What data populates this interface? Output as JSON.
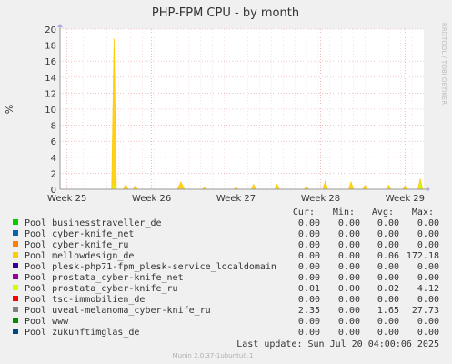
{
  "chart_data": {
    "type": "area",
    "title": "PHP-FPM CPU - by month",
    "ylabel": "%",
    "xlabel": "",
    "ylim": [
      0,
      20
    ],
    "y_ticks": [
      0,
      2,
      4,
      6,
      8,
      10,
      12,
      14,
      16,
      18,
      20
    ],
    "x_range_days": [
      0,
      31
    ],
    "x_ticks": [
      {
        "label": "Week 25",
        "day": 0.6
      },
      {
        "label": "Week 26",
        "day": 7.8
      },
      {
        "label": "Week 27",
        "day": 15.0
      },
      {
        "label": "Week 28",
        "day": 22.2
      },
      {
        "label": "Week 29",
        "day": 29.4
      }
    ],
    "grid": true,
    "legend_placement": "bottom",
    "stats_header": [
      "Cur:",
      "Min:",
      "Avg:",
      "Max:"
    ],
    "series": [
      {
        "name": "Pool businesstraveller_de",
        "color": "#00cc00",
        "stats": [
          "0.00",
          "0.00",
          "0.00",
          "0.00"
        ],
        "points": []
      },
      {
        "name": "Pool cyber-knife_net",
        "color": "#0066b3",
        "stats": [
          "0.00",
          "0.00",
          "0.00",
          "0.00"
        ],
        "points": []
      },
      {
        "name": "Pool cyber-knife_ru",
        "color": "#ff8000",
        "stats": [
          "0.00",
          "0.00",
          "0.00",
          "0.00"
        ],
        "points": []
      },
      {
        "name": "Pool mellowdesign_de",
        "color": "#ffcc00",
        "stats": [
          "0.00",
          "0.00",
          "0.06",
          "172.18"
        ],
        "points": [
          [
            4.4,
            0
          ],
          [
            4.6,
            18.8
          ],
          [
            4.8,
            0
          ],
          [
            5.4,
            0
          ],
          [
            5.6,
            0.6
          ],
          [
            5.8,
            0
          ],
          [
            6.2,
            0
          ],
          [
            6.4,
            0.4
          ],
          [
            6.6,
            0
          ],
          [
            10.0,
            0
          ],
          [
            10.3,
            0.9
          ],
          [
            10.6,
            0
          ],
          [
            12.1,
            0
          ],
          [
            12.3,
            0.2
          ],
          [
            12.5,
            0
          ],
          [
            14.8,
            0
          ],
          [
            15.0,
            0.2
          ],
          [
            15.2,
            0
          ],
          [
            16.3,
            0
          ],
          [
            16.5,
            0.6
          ],
          [
            16.7,
            0
          ],
          [
            18.3,
            0
          ],
          [
            18.5,
            0.6
          ],
          [
            18.7,
            0
          ],
          [
            20.8,
            0
          ],
          [
            21.0,
            0.3
          ],
          [
            21.2,
            0
          ],
          [
            22.4,
            0
          ],
          [
            22.6,
            1.0
          ],
          [
            22.8,
            0
          ],
          [
            24.6,
            0
          ],
          [
            24.8,
            0.9
          ],
          [
            25.0,
            0
          ],
          [
            25.8,
            0
          ],
          [
            26.0,
            0.5
          ],
          [
            26.2,
            0
          ],
          [
            27.8,
            0
          ],
          [
            28.0,
            0.5
          ],
          [
            28.2,
            0
          ],
          [
            29.2,
            0
          ],
          [
            29.4,
            0.4
          ],
          [
            29.6,
            0
          ],
          [
            30.5,
            0
          ],
          [
            30.7,
            1.3
          ],
          [
            30.9,
            0
          ]
        ]
      },
      {
        "name": "Pool plesk-php71-fpm_plesk-service_localdomain",
        "color": "#330099",
        "stats": [
          "0.00",
          "0.00",
          "0.00",
          "0.00"
        ],
        "points": []
      },
      {
        "name": "Pool prostata_cyber-knife_net",
        "color": "#990099",
        "stats": [
          "0.00",
          "0.00",
          "0.00",
          "0.00"
        ],
        "points": []
      },
      {
        "name": "Pool prostata_cyber-knife_ru",
        "color": "#ccff00",
        "stats": [
          "0.01",
          "0.00",
          "0.02",
          "4.12"
        ],
        "points": [
          [
            4.5,
            0
          ],
          [
            4.6,
            0.6
          ],
          [
            4.7,
            0
          ],
          [
            30.6,
            0
          ],
          [
            30.7,
            0.8
          ],
          [
            30.8,
            0
          ]
        ]
      },
      {
        "name": "Pool tsc-immobilien_de",
        "color": "#ff0000",
        "stats": [
          "0.00",
          "0.00",
          "0.00",
          "0.00"
        ],
        "points": []
      },
      {
        "name": "Pool uveal-melanoma_cyber-knife_ru",
        "color": "#808080",
        "stats": [
          "2.35",
          "0.00",
          "1.65",
          "27.73"
        ],
        "points": []
      },
      {
        "name": "Pool www",
        "color": "#008f00",
        "stats": [
          "0.00",
          "0.00",
          "0.00",
          "0.00"
        ],
        "points": []
      },
      {
        "name": "Pool zukunftimglas_de",
        "color": "#00487d",
        "stats": [
          "0.00",
          "0.00",
          "0.00",
          "0.00"
        ],
        "points": []
      }
    ],
    "last_update": "Last update: Sun Jul 20 04:00:06 2025",
    "side_label": "RRDTOOL / TOBI OETIKER",
    "footer": "Munin 2.0.37-1ubuntu0.1"
  }
}
